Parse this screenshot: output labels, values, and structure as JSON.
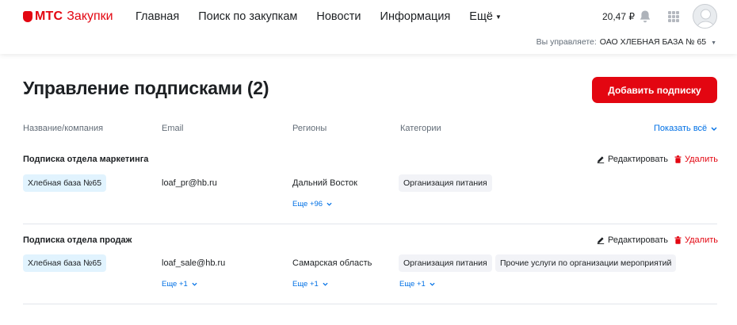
{
  "header": {
    "logo_brand": "МТС",
    "logo_text": "Закупки",
    "nav": [
      "Главная",
      "Поиск по закупкам",
      "Новости",
      "Информация",
      "Ещё"
    ],
    "balance": "20,47 ₽",
    "manage_label": "Вы управляете:",
    "manage_org": "ОАО ХЛЕБНАЯ БАЗА № 65"
  },
  "main": {
    "title": "Управление подписками (2)",
    "add_button": "Добавить подписку",
    "columns": [
      "Название/компания",
      "Email",
      "Регионы",
      "Категории"
    ],
    "show_all": "Показать всё",
    "edit_label": "Редактировать",
    "delete_label": "Удалить"
  },
  "subscriptions": [
    {
      "name": "Подписка отдела маркетинга",
      "company": "Хлебная база №65",
      "email": "loaf_pr@hb.ru",
      "region": "Дальний Восток",
      "region_more": "Еще +96",
      "categories": [
        "Организация питания"
      ]
    },
    {
      "name": "Подписка отдела продаж",
      "company": "Хлебная база №65",
      "email": "loaf_sale@hb.ru",
      "email_more": "Еще +1",
      "region": "Самарская область",
      "region_more": "Еще +1",
      "categories": [
        "Организация питания",
        "Прочие услуги по организации мероприятий"
      ],
      "categories_more": "Еще +1"
    }
  ],
  "colors": {
    "brand_red": "#e30611",
    "link_blue": "#0070e5",
    "company_chip": "#e1f3fe",
    "category_chip": "#f2f3f7"
  }
}
